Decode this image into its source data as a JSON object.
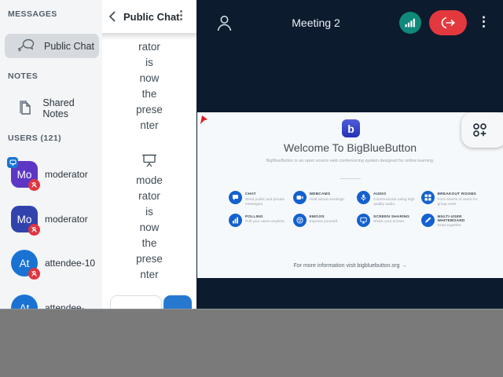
{
  "colors": {
    "navy": "#0c1b2e",
    "teal_connection": "#10887a",
    "red_leave": "#e3383e",
    "accent_blue": "#2779d0",
    "feature_icon_blue": "#1461cf",
    "gray_filler": "#7a7a7a"
  },
  "sidebar": {
    "messages_header": "MESSAGES",
    "public_chat_label": "Public Chat",
    "notes_header": "NOTES",
    "shared_notes_label": "Shared Notes",
    "users_header": "USERS (121)",
    "users": [
      {
        "initials": "Mo",
        "name": "moderator",
        "avatar_color": "#5d36c5",
        "shape": "square",
        "presenter": true,
        "muted_badge": true
      },
      {
        "initials": "Mo",
        "name": "moderator",
        "avatar_color": "#3242ad",
        "shape": "square",
        "presenter": false,
        "muted_badge": true
      },
      {
        "initials": "At",
        "name": "attendee-10",
        "avatar_color": "#1a73d2",
        "shape": "circle",
        "presenter": false,
        "muted_badge": true
      },
      {
        "initials": "At",
        "name": "attendee-",
        "avatar_color": "#1a73d2",
        "shape": "circle",
        "presenter": false,
        "muted_badge": true
      }
    ]
  },
  "chat": {
    "title": "Public Chat",
    "menu_glyph": "⋮",
    "message1_lines": [
      "rator",
      "is",
      "now",
      "the",
      "prese",
      "nter"
    ],
    "message2_lines": [
      "mode",
      "rator",
      "is",
      "now",
      "the",
      "prese",
      "nter"
    ],
    "input_value": ""
  },
  "meeting": {
    "title": "Meeting 2",
    "kebab_glyph": "⋮"
  },
  "slide": {
    "logo_letter": "b",
    "heading": "Welcome To BigBlueButton",
    "subheading": "BigBlueButton is an open source web conferencing system designed for online learning.",
    "features": [
      {
        "title": "CHAT",
        "desc": "Send public and private messages."
      },
      {
        "title": "WEBCAMS",
        "desc": "Hold visual meetings."
      },
      {
        "title": "AUDIO",
        "desc": "Communicate using high quality audio."
      },
      {
        "title": "BREAKOUT ROOMS",
        "desc": "Form teams of users for group work"
      },
      {
        "title": "POLLING",
        "desc": "Poll your users anytime."
      },
      {
        "title": "EMOJIS",
        "desc": "Express yourself."
      },
      {
        "title": "SCREEN SHARING",
        "desc": "Share your screen."
      },
      {
        "title": "MULTI-USER WHITEBOARD",
        "desc": "Draw together."
      }
    ],
    "footer": "For more information visit bigbluebutton.org →"
  }
}
